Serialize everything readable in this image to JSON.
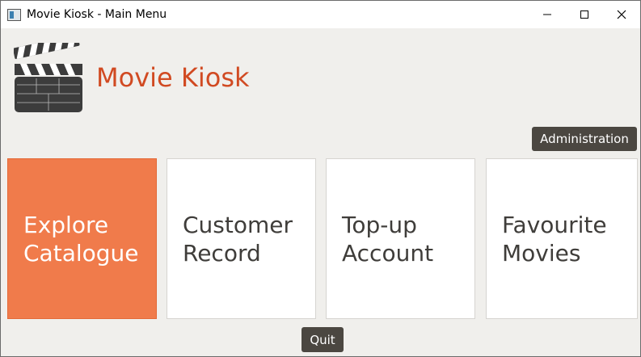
{
  "window": {
    "title": "Movie Kiosk - Main Menu",
    "icon": "app-window-icon",
    "controls": [
      "minimize-icon",
      "maximize-icon",
      "close-icon"
    ]
  },
  "header": {
    "title": "Movie Kiosk",
    "logo_icon": "clapperboard-icon",
    "title_color": "#d14a22"
  },
  "admin_button": {
    "label": "Administration"
  },
  "tiles": [
    {
      "line1": "Explore",
      "line2": "Catalogue",
      "selected": true
    },
    {
      "line1": "Customer",
      "line2": "Record",
      "selected": false
    },
    {
      "line1": "Top-up",
      "line2": "Account",
      "selected": false
    },
    {
      "line1": "Favourite",
      "line2": "Movies",
      "selected": false
    }
  ],
  "quit_button": {
    "label": "Quit"
  },
  "colors": {
    "accent": "#f07b4b",
    "button_bg": "#4b4741",
    "background": "#f0efec"
  }
}
